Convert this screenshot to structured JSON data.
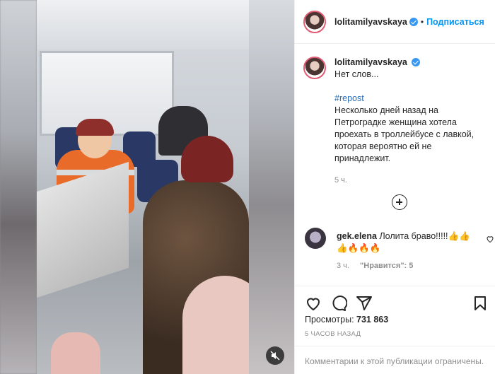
{
  "post": {
    "username": "lolitamilyavskaya",
    "dot": "•",
    "follow_label": "Подписаться",
    "caption_lines": [
      "Нет слов...",
      "#repost",
      "Несколько дней назад на",
      "Петроградке женщина хотела",
      "проехать в троллейбусе с лавкой,",
      "которая вероятно ей не",
      "принадлежит."
    ],
    "caption_time": "5 ч.",
    "views_label": "Просмотры:",
    "views_count": "731 863",
    "posted_ago": "5 ЧАСОВ НАЗАД",
    "comments_limited": "Комментарии к этой публикации ограничены."
  },
  "comment": {
    "username": "gek.elena",
    "text": "Лолита браво!!!!!👍👍",
    "text_line2": "👍🔥🔥🔥",
    "time": "3 ч.",
    "likes": "\"Нравится\": 5"
  },
  "icons": {
    "verified": "verified-badge-icon",
    "mute": "speaker-muted-icon",
    "expand": "plus-circle-icon",
    "like": "heart-icon",
    "comment": "speech-bubble-icon",
    "share": "paper-plane-icon",
    "save": "bookmark-icon"
  },
  "colors": {
    "accent": "#0095f6",
    "hashtag": "#2b6fb6",
    "muted_text": "#8e8e8e"
  }
}
